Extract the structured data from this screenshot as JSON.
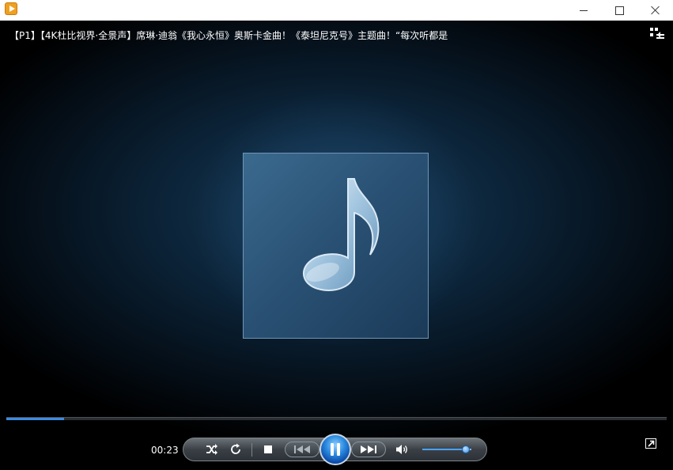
{
  "window": {
    "app_icon": "player-icon",
    "controls": [
      "minimize-icon",
      "maximize-icon",
      "close-icon"
    ]
  },
  "video": {
    "title": "【P1】【4K杜比视界·全景声】席琳·迪翁《我心永恒》奥斯卡金曲！《泰坦尼克号》主题曲！“每次听都是",
    "album_art_icon": "music-note-icon"
  },
  "playback": {
    "current_time": "00:23",
    "progress_fraction": 0.088,
    "volume_fraction": 0.88,
    "state": "playing"
  },
  "controls": {
    "icons": [
      "shuffle-icon",
      "repeat-icon",
      "stop-icon",
      "previous-icon",
      "pause-icon",
      "next-icon",
      "volume-icon",
      "playlist-icon",
      "picture-in-picture-icon"
    ]
  },
  "colors": {
    "accent": "#2c8be0",
    "seek_fill": "#3d8ae0",
    "background": "#000000"
  }
}
